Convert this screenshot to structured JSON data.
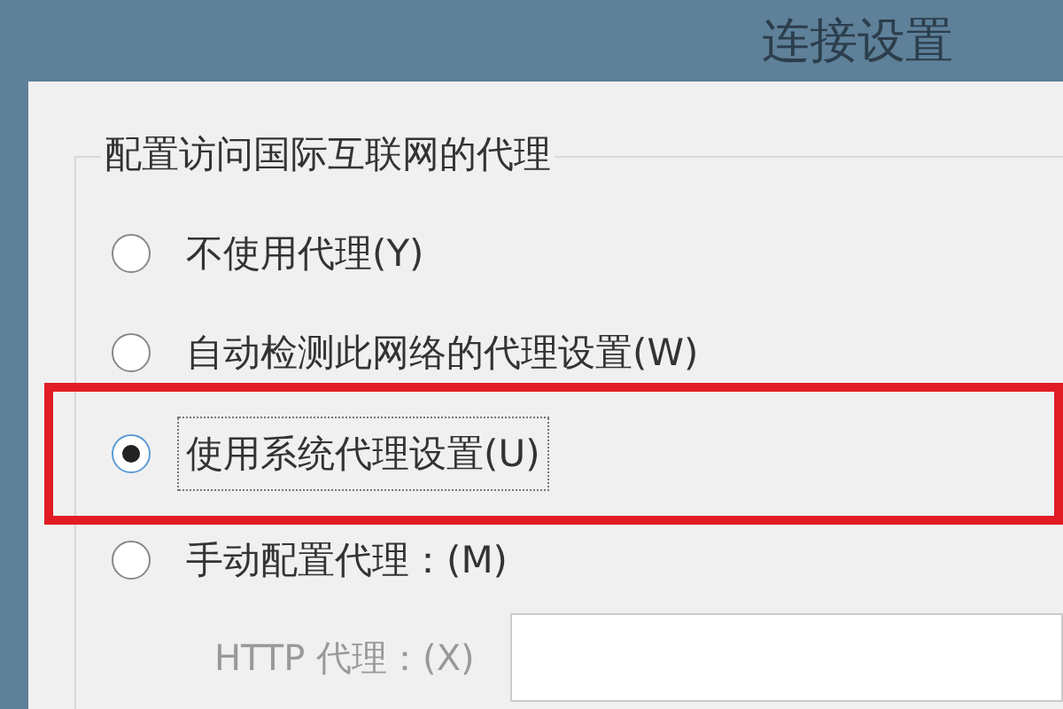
{
  "window": {
    "title": "连接设置"
  },
  "group": {
    "label": "配置访问国际互联网的代理",
    "options": [
      {
        "label": "不使用代理(Y)",
        "selected": false,
        "highlighted": false
      },
      {
        "label": "自动检测此网络的代理设置(W)",
        "selected": false,
        "highlighted": false
      },
      {
        "label": "使用系统代理设置(U)",
        "selected": true,
        "highlighted": true
      },
      {
        "label": "手动配置代理：(M)",
        "selected": false,
        "highlighted": false
      }
    ],
    "http_proxy": {
      "label": "HTTP 代理：(X)",
      "disabled": true
    }
  }
}
